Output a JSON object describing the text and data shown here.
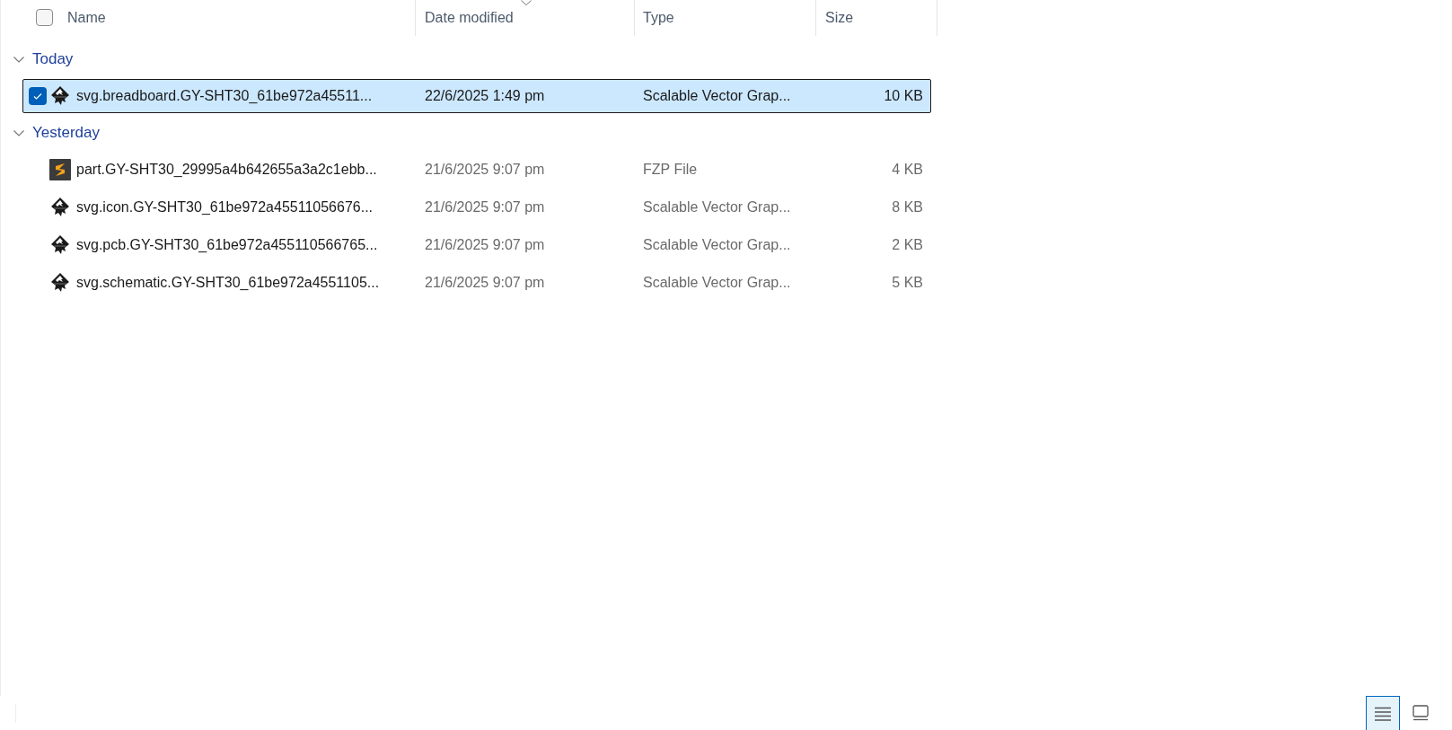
{
  "header": {
    "select_all": {
      "checked": false
    },
    "columns": [
      {
        "label": "Name",
        "sorted": false
      },
      {
        "label": "Date modified",
        "sorted": true
      },
      {
        "label": "Type",
        "sorted": false
      },
      {
        "label": "Size",
        "sorted": false
      }
    ]
  },
  "groups": [
    {
      "label": "Today",
      "expanded": true,
      "files": [
        {
          "kind": "vector",
          "name": "svg.breadboard.GY-SHT30_61be972a45511...",
          "date": "22/6/2025 1:49 pm",
          "type": "Scalable Vector Grap...",
          "size": "10 KB",
          "selected": true
        }
      ]
    },
    {
      "label": "Yesterday",
      "expanded": true,
      "files": [
        {
          "kind": "part",
          "name": "part.GY-SHT30_29995a4b642655a3a2c1ebb...",
          "date": "21/6/2025 9:07 pm",
          "type": "FZP File",
          "size": "4 KB",
          "selected": false
        },
        {
          "kind": "vector",
          "name": "svg.icon.GY-SHT30_61be972a45511056676...",
          "date": "21/6/2025 9:07 pm",
          "type": "Scalable Vector Grap...",
          "size": "8 KB",
          "selected": false
        },
        {
          "kind": "vector",
          "name": "svg.pcb.GY-SHT30_61be972a455110566765...",
          "date": "21/6/2025 9:07 pm",
          "type": "Scalable Vector Grap...",
          "size": "2 KB",
          "selected": false
        },
        {
          "kind": "vector",
          "name": "svg.schematic.GY-SHT30_61be972a4551105...",
          "date": "21/6/2025 9:07 pm",
          "type": "Scalable Vector Grap...",
          "size": "5 KB",
          "selected": false
        }
      ]
    }
  ],
  "view_buttons": [
    {
      "kind": "details",
      "selected": true
    },
    {
      "kind": "tiles",
      "selected": false
    }
  ]
}
